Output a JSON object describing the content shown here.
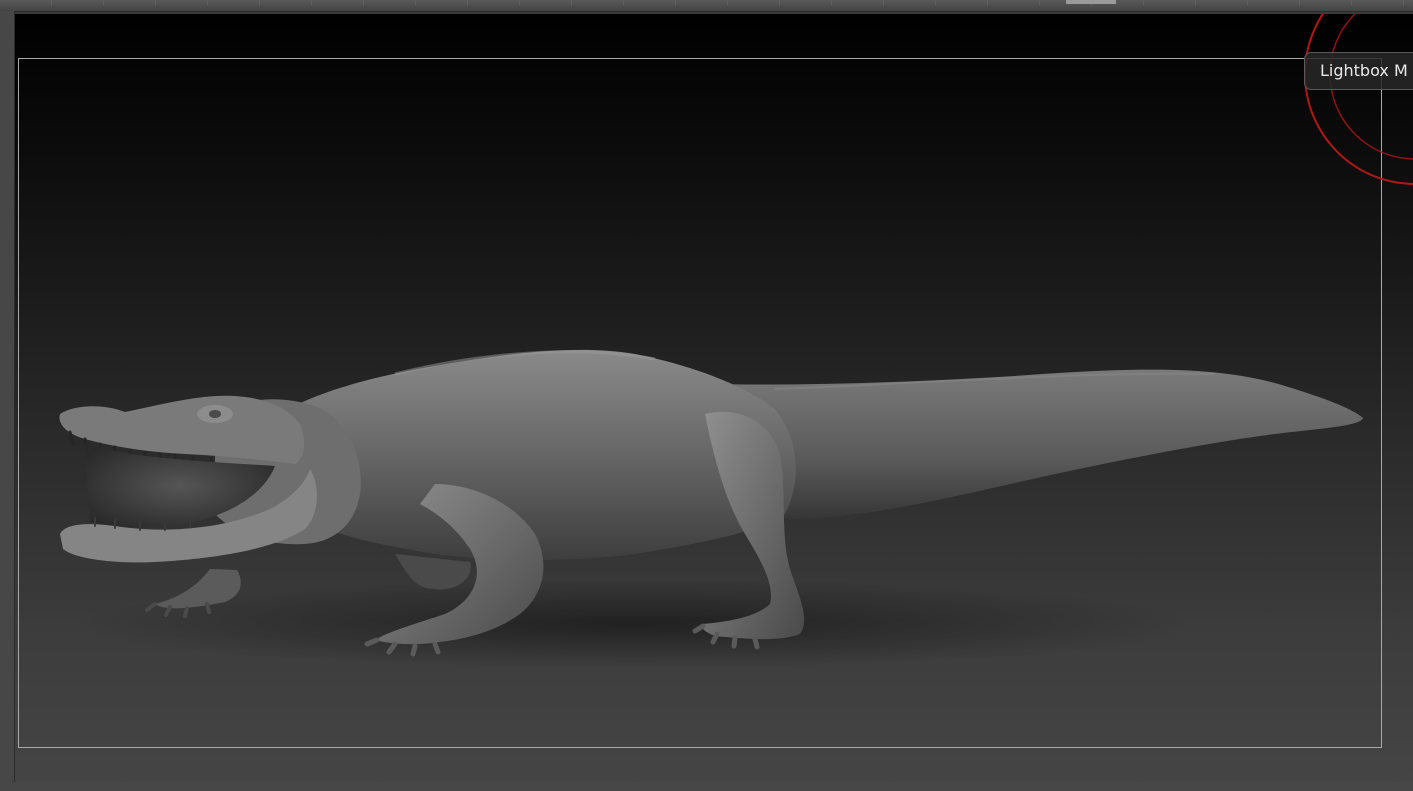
{
  "app": {
    "lightbox_button_label": "Lightbox M"
  },
  "colors": {
    "canvas_top": "#000000",
    "canvas_bottom": "#454545",
    "frame_border": "#a9a9a9",
    "compass_red": "#b01818",
    "model_gray": "#808080"
  },
  "icons": {
    "compass": "navigation-gyro-icon"
  }
}
